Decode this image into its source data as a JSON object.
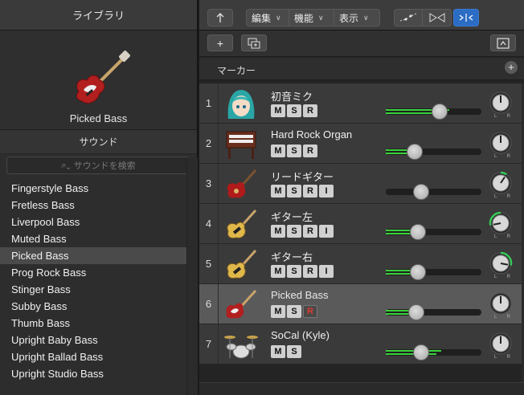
{
  "library": {
    "title": "ライブラリ",
    "preview_name": "Picked Bass",
    "sound_header": "サウンド",
    "search_placeholder": "サウンドを検索",
    "items": [
      {
        "label": "Fingerstyle Bass",
        "selected": false
      },
      {
        "label": "Fretless Bass",
        "selected": false
      },
      {
        "label": "Liverpool Bass",
        "selected": false
      },
      {
        "label": "Muted Bass",
        "selected": false
      },
      {
        "label": "Picked Bass",
        "selected": true
      },
      {
        "label": "Prog Rock Bass",
        "selected": false
      },
      {
        "label": "Stinger Bass",
        "selected": false
      },
      {
        "label": "Subby Bass",
        "selected": false
      },
      {
        "label": "Thumb Bass",
        "selected": false
      },
      {
        "label": "Upright Baby Bass",
        "selected": false
      },
      {
        "label": "Upright Ballad Bass",
        "selected": false
      },
      {
        "label": "Upright Studio Bass",
        "selected": false
      }
    ]
  },
  "toolbar": {
    "edit": "編集",
    "function": "機能",
    "view": "表示"
  },
  "header": {
    "add": "+",
    "markers": "マーカー",
    "marker_add": "+"
  },
  "colors": {
    "accent": "#2b6cc4",
    "meter": "#38d23a",
    "record_red": "#e03a2f",
    "pan_green": "#37c957"
  },
  "tracks": [
    {
      "num": "1",
      "name": "初音ミク",
      "icon": "vocal-character-icon",
      "buttons": [
        "M",
        "S",
        "R"
      ],
      "fader": 0.56,
      "level": 0.66,
      "pan": 0.0,
      "selected": false
    },
    {
      "num": "2",
      "name": "Hard Rock Organ",
      "icon": "organ-icon",
      "buttons": [
        "M",
        "S",
        "R"
      ],
      "fader": 0.3,
      "level": 0.35,
      "pan": 0.0,
      "selected": false
    },
    {
      "num": "3",
      "name": "リードギター",
      "icon": "electric-guitar-icon",
      "buttons": [
        "M",
        "S",
        "R",
        "I"
      ],
      "fader": 0.37,
      "level": 0.0,
      "pan": 0.25,
      "selected": false
    },
    {
      "num": "4",
      "name": "ギター左",
      "icon": "guitar-icon",
      "buttons": [
        "M",
        "S",
        "R",
        "I"
      ],
      "fader": 0.34,
      "level": 0.34,
      "pan": -0.75,
      "selected": false
    },
    {
      "num": "5",
      "name": "ギター右",
      "icon": "guitar-icon",
      "buttons": [
        "M",
        "S",
        "R",
        "I"
      ],
      "fader": 0.34,
      "level": 0.34,
      "pan": 0.75,
      "selected": false
    },
    {
      "num": "6",
      "name": "Picked Bass",
      "icon": "bass-guitar-icon",
      "buttons": [
        "M",
        "S",
        "R"
      ],
      "fader": 0.32,
      "level": 0.38,
      "pan": 0.0,
      "selected": true
    },
    {
      "num": "7",
      "name": "SoCal (Kyle)",
      "icon": "drum-kit-icon",
      "buttons": [
        "M",
        "S"
      ],
      "fader": 0.37,
      "level": 0.58,
      "pan": 0.0,
      "selected": false
    }
  ],
  "pan_labels": {
    "left": "L",
    "right": "R"
  }
}
